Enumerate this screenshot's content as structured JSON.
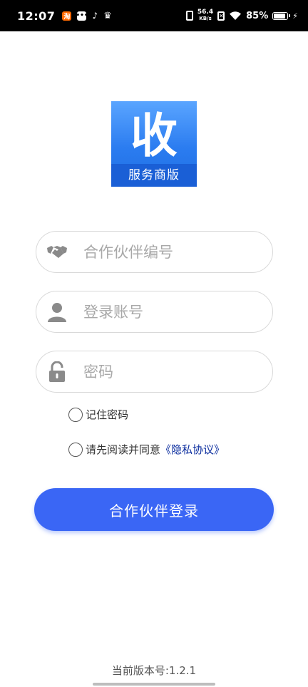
{
  "status_bar": {
    "time": "12:07",
    "notif_taobao": "淘",
    "notif_chat": "•••",
    "notif_tiktok": "♪",
    "notif_crown": "♛",
    "net_speed": "56.4",
    "net_unit": "KB/s",
    "nosim": "✕",
    "battery": "85%",
    "charge": "⚡"
  },
  "logo": {
    "mark": "收",
    "band_text": "服务商版"
  },
  "form": {
    "partner_placeholder": "合作伙伴编号",
    "account_placeholder": "登录账号",
    "password_placeholder": "密码",
    "remember_label": "记住密码",
    "agree_label": "请先阅读并同意",
    "privacy_link": "《隐私协议》",
    "login_label": "合作伙伴登录"
  },
  "footer": {
    "version": "当前版本号:1.2.1"
  },
  "colors": {
    "primary": "#3a66f5",
    "link": "#0a2c9e",
    "icon_gray": "#8a8a8a"
  }
}
